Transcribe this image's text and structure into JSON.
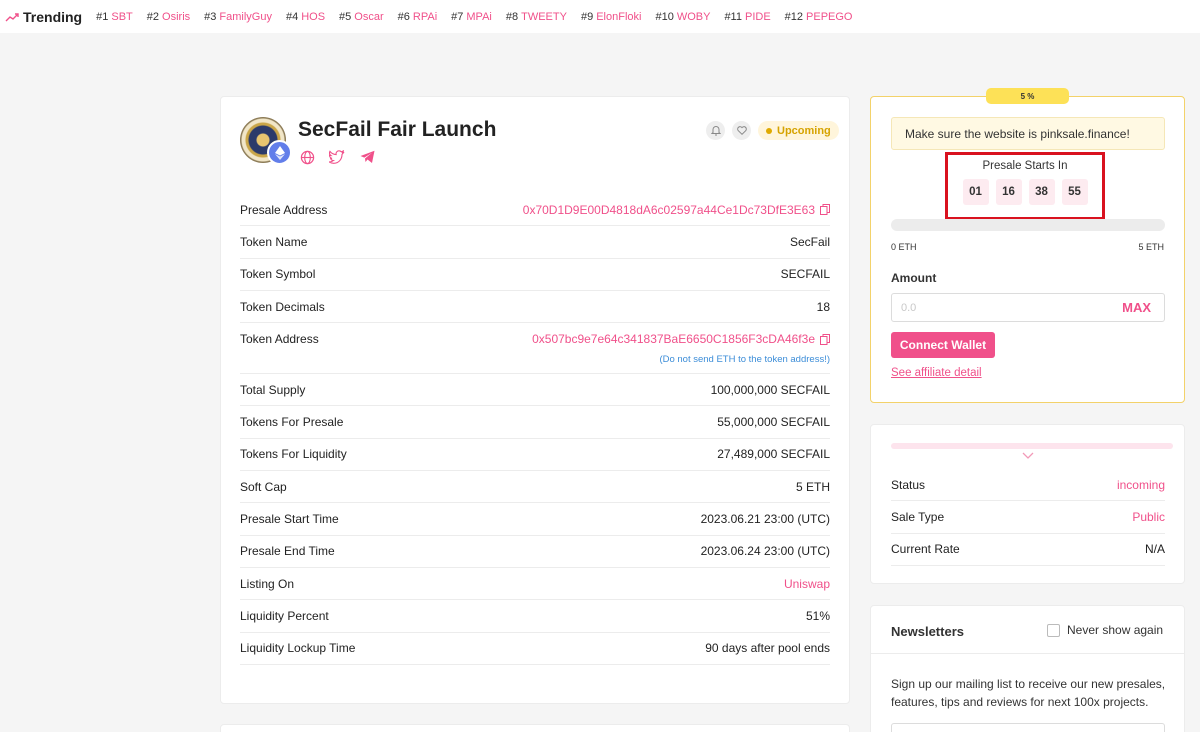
{
  "trending": {
    "title": "Trending",
    "items": [
      {
        "rank": "#1",
        "name": "SBT"
      },
      {
        "rank": "#2",
        "name": "Osiris"
      },
      {
        "rank": "#3",
        "name": "FamilyGuy"
      },
      {
        "rank": "#4",
        "name": "HOS"
      },
      {
        "rank": "#5",
        "name": "Oscar"
      },
      {
        "rank": "#6",
        "name": "RPAi"
      },
      {
        "rank": "#7",
        "name": "MPAi"
      },
      {
        "rank": "#8",
        "name": "TWEETY"
      },
      {
        "rank": "#9",
        "name": "ElonFloki"
      },
      {
        "rank": "#10",
        "name": "WOBY"
      },
      {
        "rank": "#11",
        "name": "PIDE"
      },
      {
        "rank": "#12",
        "name": "PEPEGO"
      }
    ]
  },
  "project": {
    "title": "SecFail Fair Launch",
    "status_badge": "Upcoming",
    "rows": {
      "presale_address": {
        "label": "Presale Address",
        "value": "0x70D1D9E00D4818dA6c02597a44Ce1Dc73DfE3E63"
      },
      "token_name": {
        "label": "Token Name",
        "value": "SecFail"
      },
      "token_symbol": {
        "label": "Token Symbol",
        "value": "SECFAIL"
      },
      "token_decimals": {
        "label": "Token Decimals",
        "value": "18"
      },
      "token_address": {
        "label": "Token Address",
        "value": "0x507bc9e7e64c341837BaE6650C1856F3cDA46f3e",
        "note": "(Do not send ETH to the token address!)"
      },
      "total_supply": {
        "label": "Total Supply",
        "value": "100,000,000 SECFAIL"
      },
      "tokens_presale": {
        "label": "Tokens For Presale",
        "value": "55,000,000 SECFAIL"
      },
      "tokens_liquidity": {
        "label": "Tokens For Liquidity",
        "value": "27,489,000 SECFAIL"
      },
      "soft_cap": {
        "label": "Soft Cap",
        "value": "5 ETH"
      },
      "start_time": {
        "label": "Presale Start Time",
        "value": "2023.06.21 23:00 (UTC)"
      },
      "end_time": {
        "label": "Presale End Time",
        "value": "2023.06.24 23:00 (UTC)"
      },
      "listing_on": {
        "label": "Listing On",
        "value": "Uniswap"
      },
      "liquidity_percent": {
        "label": "Liquidity Percent",
        "value": "51%"
      },
      "lockup_time": {
        "label": "Liquidity Lockup Time",
        "value": "90 days after pool ends"
      }
    }
  },
  "presale": {
    "percent_badge": "5 %",
    "notice": "Make sure the website is pinksale.finance!",
    "countdown_title": "Presale Starts In",
    "countdown": [
      "01",
      "16",
      "38",
      "55"
    ],
    "progress_fraction": 0,
    "min_label": "0 ETH",
    "max_label": "5 ETH",
    "amount_label": "Amount",
    "amount_placeholder": "0.0",
    "max_button": "MAX",
    "connect_button": "Connect Wallet",
    "affiliate_link": "See affiliate detail"
  },
  "status": {
    "rows": [
      {
        "label": "Status",
        "value": "incoming"
      },
      {
        "label": "Sale Type",
        "value": "Public"
      },
      {
        "label": "Current Rate",
        "value": "N/A"
      }
    ]
  },
  "newsletter": {
    "title": "Newsletters",
    "never_show": "Never show again",
    "body": "Sign up our mailing list to receive our new presales, features, tips and reviews for next 100x projects."
  },
  "colors": {
    "accent": "#f0508a",
    "badge_yellow": "#fde157",
    "highlight_red": "#d9121f"
  }
}
